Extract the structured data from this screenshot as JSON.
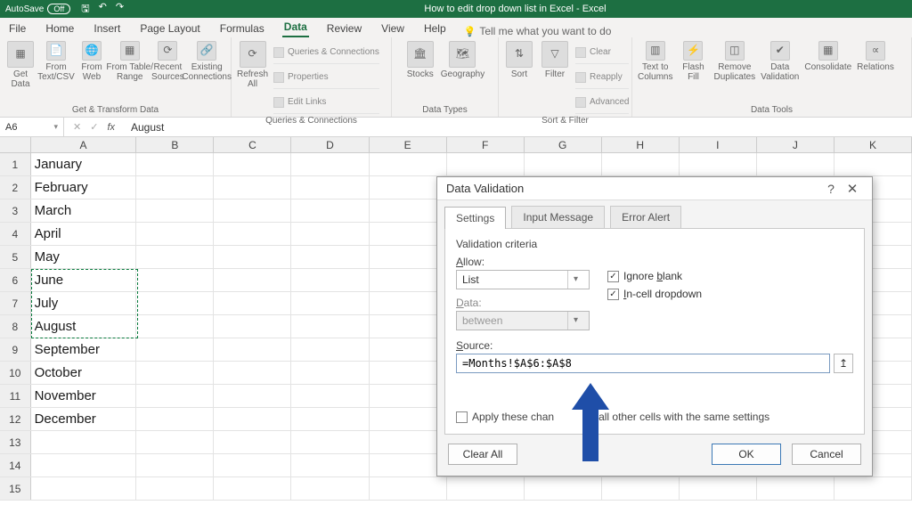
{
  "titlebar": {
    "autosave_label": "AutoSave",
    "autosave_state": "Off",
    "doc_title": "How to edit drop down list in Excel  -  Excel"
  },
  "menu": {
    "tabs": [
      "File",
      "Home",
      "Insert",
      "Page Layout",
      "Formulas",
      "Data",
      "Review",
      "View",
      "Help"
    ],
    "active": "Data",
    "tell_me": "Tell me what you want to do"
  },
  "ribbon": {
    "groups": {
      "get_transform": {
        "label": "Get & Transform Data",
        "buttons": [
          "Get\nData",
          "From\nText/CSV",
          "From\nWeb",
          "From Table/\nRange",
          "Recent\nSources",
          "Existing\nConnections"
        ]
      },
      "queries": {
        "label": "Queries & Connections",
        "refresh_btn": "Refresh\nAll",
        "rows": [
          "Queries & Connections",
          "Properties",
          "Edit Links"
        ]
      },
      "data_types": {
        "label": "Data Types",
        "buttons": [
          "Stocks",
          "Geography"
        ]
      },
      "sort_filter": {
        "label": "Sort & Filter",
        "sort_btn": "Sort",
        "filter_btn": "Filter",
        "rows": [
          "Clear",
          "Reapply",
          "Advanced"
        ]
      },
      "data_tools": {
        "label": "Data Tools",
        "buttons": [
          "Text to\nColumns",
          "Flash\nFill",
          "Remove\nDuplicates",
          "Data\nValidation",
          "Consolidate",
          "Relations"
        ]
      }
    }
  },
  "namebox": {
    "ref": "A6"
  },
  "formula_bar": {
    "fx": "fx",
    "value": "August"
  },
  "columns": [
    "A",
    "B",
    "C",
    "D",
    "E",
    "F",
    "G",
    "H",
    "I",
    "J",
    "K"
  ],
  "rows": {
    "count": 15,
    "colA": {
      "1": "January",
      "2": "February",
      "3": "March",
      "4": "April",
      "5": "May",
      "6": "June",
      "7": "July",
      "8": "August",
      "9": "September",
      "10": "October",
      "11": "November",
      "12": "December"
    }
  },
  "dialog": {
    "title": "Data Validation",
    "tabs": [
      "Settings",
      "Input Message",
      "Error Alert"
    ],
    "active_tab": "Settings",
    "criteria_label": "Validation criteria",
    "allow_label": "Allow:",
    "allow_value": "List",
    "data_label": "Data:",
    "data_value": "between",
    "ignore_blank": "Ignore blank",
    "incell_dd": "In-cell dropdown",
    "source_label": "Source:",
    "source_value": "=Months!$A$6:$A$8",
    "apply_label_before": "Apply these chan",
    "apply_label_after": "o all other cells with the same settings",
    "clear_all": "Clear All",
    "ok": "OK",
    "cancel": "Cancel"
  },
  "chart_data": null
}
